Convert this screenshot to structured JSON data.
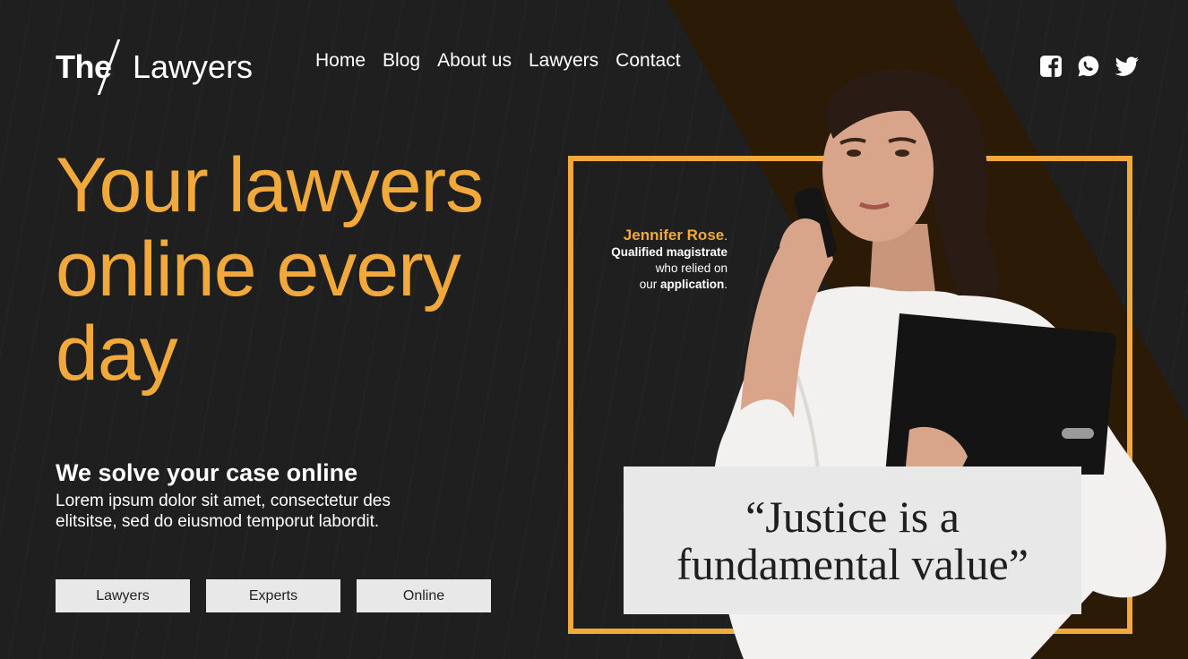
{
  "logo": {
    "part1": "The",
    "part2": "Lawyers"
  },
  "nav": [
    "Home",
    "Blog",
    "About us",
    "Lawyers",
    "Contact"
  ],
  "social": [
    "facebook-icon",
    "whatsapp-icon",
    "twitter-icon"
  ],
  "hero": {
    "line1": "Your lawyers",
    "line2": "online every",
    "line3": "day"
  },
  "section": {
    "title": "We solve your case online",
    "text": "Lorem ipsum dolor sit amet, consectetur des elitsitse, sed do eiusmod temporut labordit."
  },
  "buttons": [
    "Lawyers",
    "Experts",
    "Online"
  ],
  "testimonial": {
    "name": "Jennifer Rose",
    "role": "Qualified magistrate",
    "line2": "who relied on",
    "line3_prefix": "our",
    "line3_bold": "application"
  },
  "quote": {
    "line1": "“Justice is a",
    "line2": "fundamental value”"
  },
  "colors": {
    "accent": "#f2a93b",
    "background": "#1f1f1f",
    "panel": "#e8e8e8"
  }
}
